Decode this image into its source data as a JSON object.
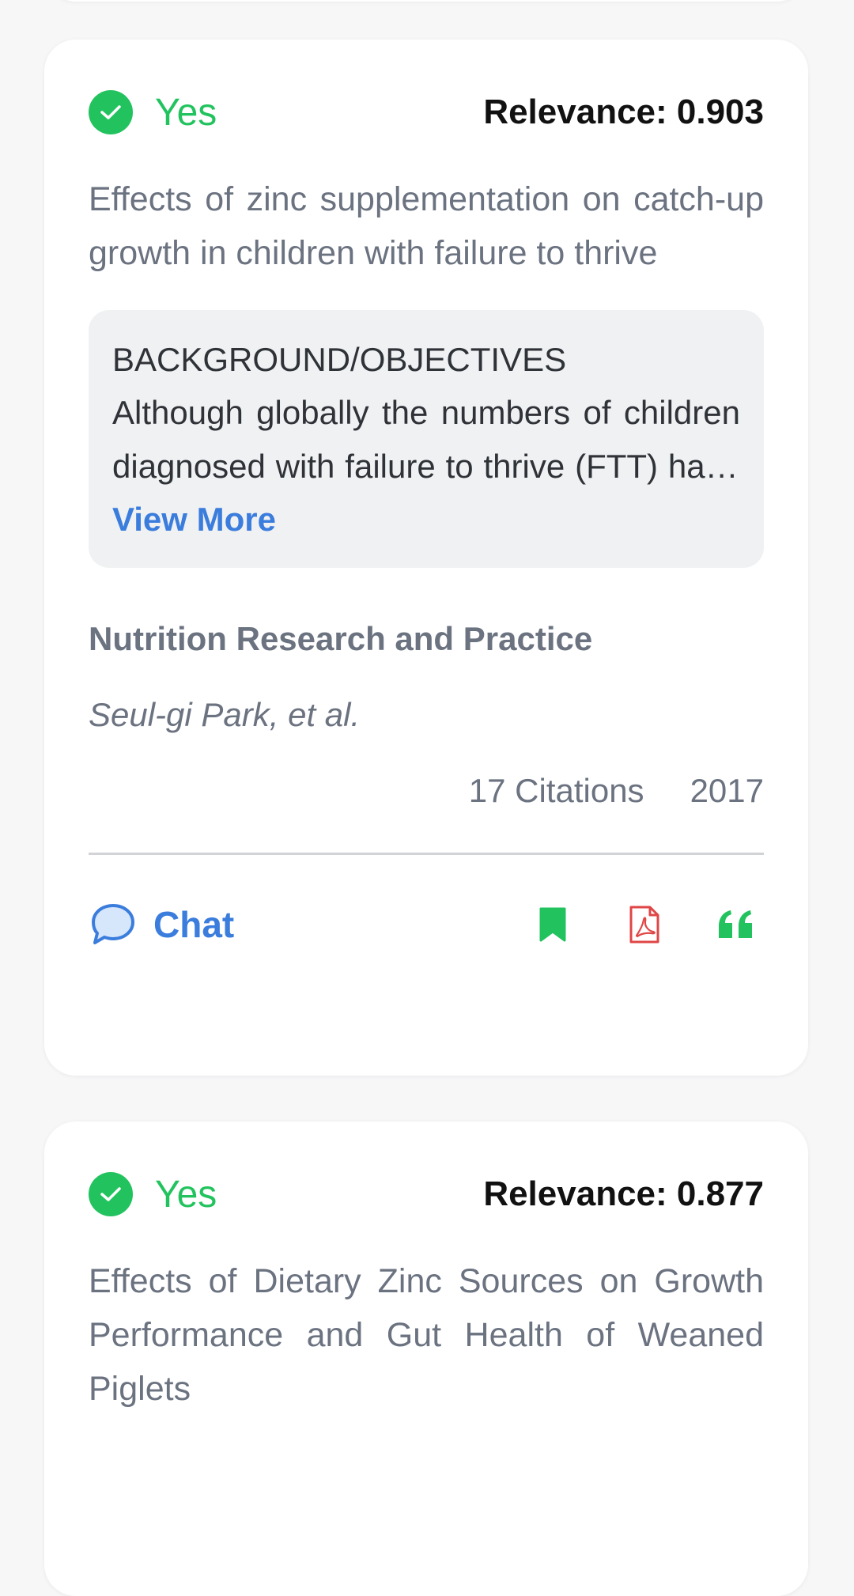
{
  "colors": {
    "verdict_green": "#22c35e",
    "link_blue": "#3b7ddd",
    "pdf_red": "#e04646",
    "muted_text": "#6b7280",
    "abstract_bg": "#f0f1f3"
  },
  "results": [
    {
      "verdict": "Yes",
      "relevance": "Relevance: 0.903",
      "title": "Effects of zinc supplementation on catch-up growth in children with failure to thrive",
      "abstract_heading": "BACKGROUND/OBJECTIVES",
      "abstract_text": "Although globally the numbers of children diagnosed with failure to thrive (FTT) have been decreasing, the condition remains a concern.",
      "view_more": "View More",
      "journal": "Nutrition Research and Practice",
      "authors": "Seul-gi Park, et al.",
      "citations": "17 Citations",
      "year": "2017",
      "chat_label": "Chat",
      "icons": [
        "check-circle-icon",
        "chat-bubble-icon",
        "bookmark-icon",
        "pdf-icon",
        "quote-icon"
      ]
    },
    {
      "verdict": "Yes",
      "relevance": "Relevance: 0.877",
      "title": "Effects of Dietary Zinc Sources on Growth Performance and Gut Health of Weaned Piglets"
    }
  ]
}
